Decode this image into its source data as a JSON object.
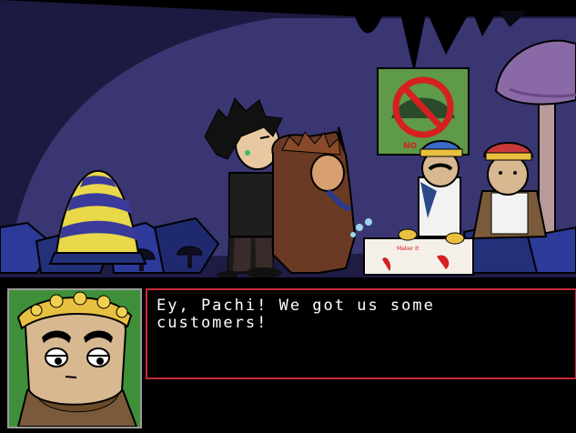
{
  "scene": {
    "sign_text": "NO",
    "tablecloth_text": "Maker It"
  },
  "dialog": {
    "text": "Ey, Pachi! We got us some\ncustomers!"
  },
  "colors": {
    "cave_bg": "#3a3672",
    "cave_floor": "#2c2a5c",
    "text_box_border": "#c8283c",
    "portrait_frame": "#9b9b9b",
    "portrait_bg": "#3f8f3a",
    "text": "#ffffff"
  }
}
